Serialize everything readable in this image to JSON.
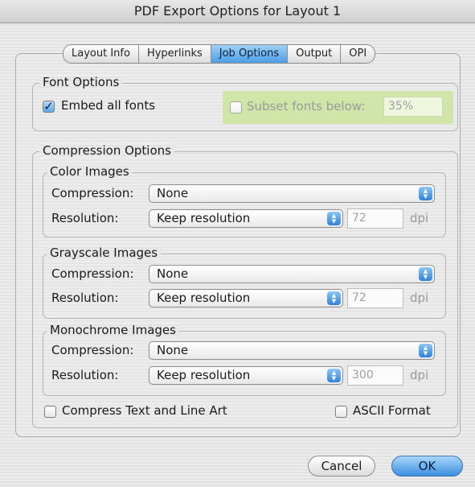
{
  "window": {
    "title": "PDF Export Options for Layout 1"
  },
  "tabs": [
    {
      "label": "Layout Info",
      "active": false
    },
    {
      "label": "Hyperlinks",
      "active": false
    },
    {
      "label": "Job Options",
      "active": true
    },
    {
      "label": "Output",
      "active": false
    },
    {
      "label": "OPI",
      "active": false
    }
  ],
  "font_options": {
    "title": "Font Options",
    "embed_all_fonts": {
      "label": "Embed all fonts",
      "checked": true
    },
    "subset_fonts": {
      "label": "Subset fonts below:",
      "checked": false,
      "value": "35%",
      "highlight_color": "#cfe6a8"
    }
  },
  "compression": {
    "title": "Compression Options",
    "groups": [
      {
        "title": "Color Images",
        "compression_label": "Compression:",
        "compression_value": "None",
        "resolution_label": "Resolution:",
        "resolution_value": "Keep resolution",
        "dpi_value": "72",
        "dpi_unit": "dpi"
      },
      {
        "title": "Grayscale Images",
        "compression_label": "Compression:",
        "compression_value": "None",
        "resolution_label": "Resolution:",
        "resolution_value": "Keep resolution",
        "dpi_value": "72",
        "dpi_unit": "dpi"
      },
      {
        "title": "Monochrome Images",
        "compression_label": "Compression:",
        "compression_value": "None",
        "resolution_label": "Resolution:",
        "resolution_value": "Keep resolution",
        "dpi_value": "300",
        "dpi_unit": "dpi"
      }
    ],
    "compress_text": {
      "label": "Compress Text and Line Art",
      "checked": false
    },
    "ascii_format": {
      "label": "ASCII Format",
      "checked": false
    }
  },
  "buttons": {
    "cancel": "Cancel",
    "ok": "OK"
  },
  "colors": {
    "accent": "#4c9ee6"
  }
}
